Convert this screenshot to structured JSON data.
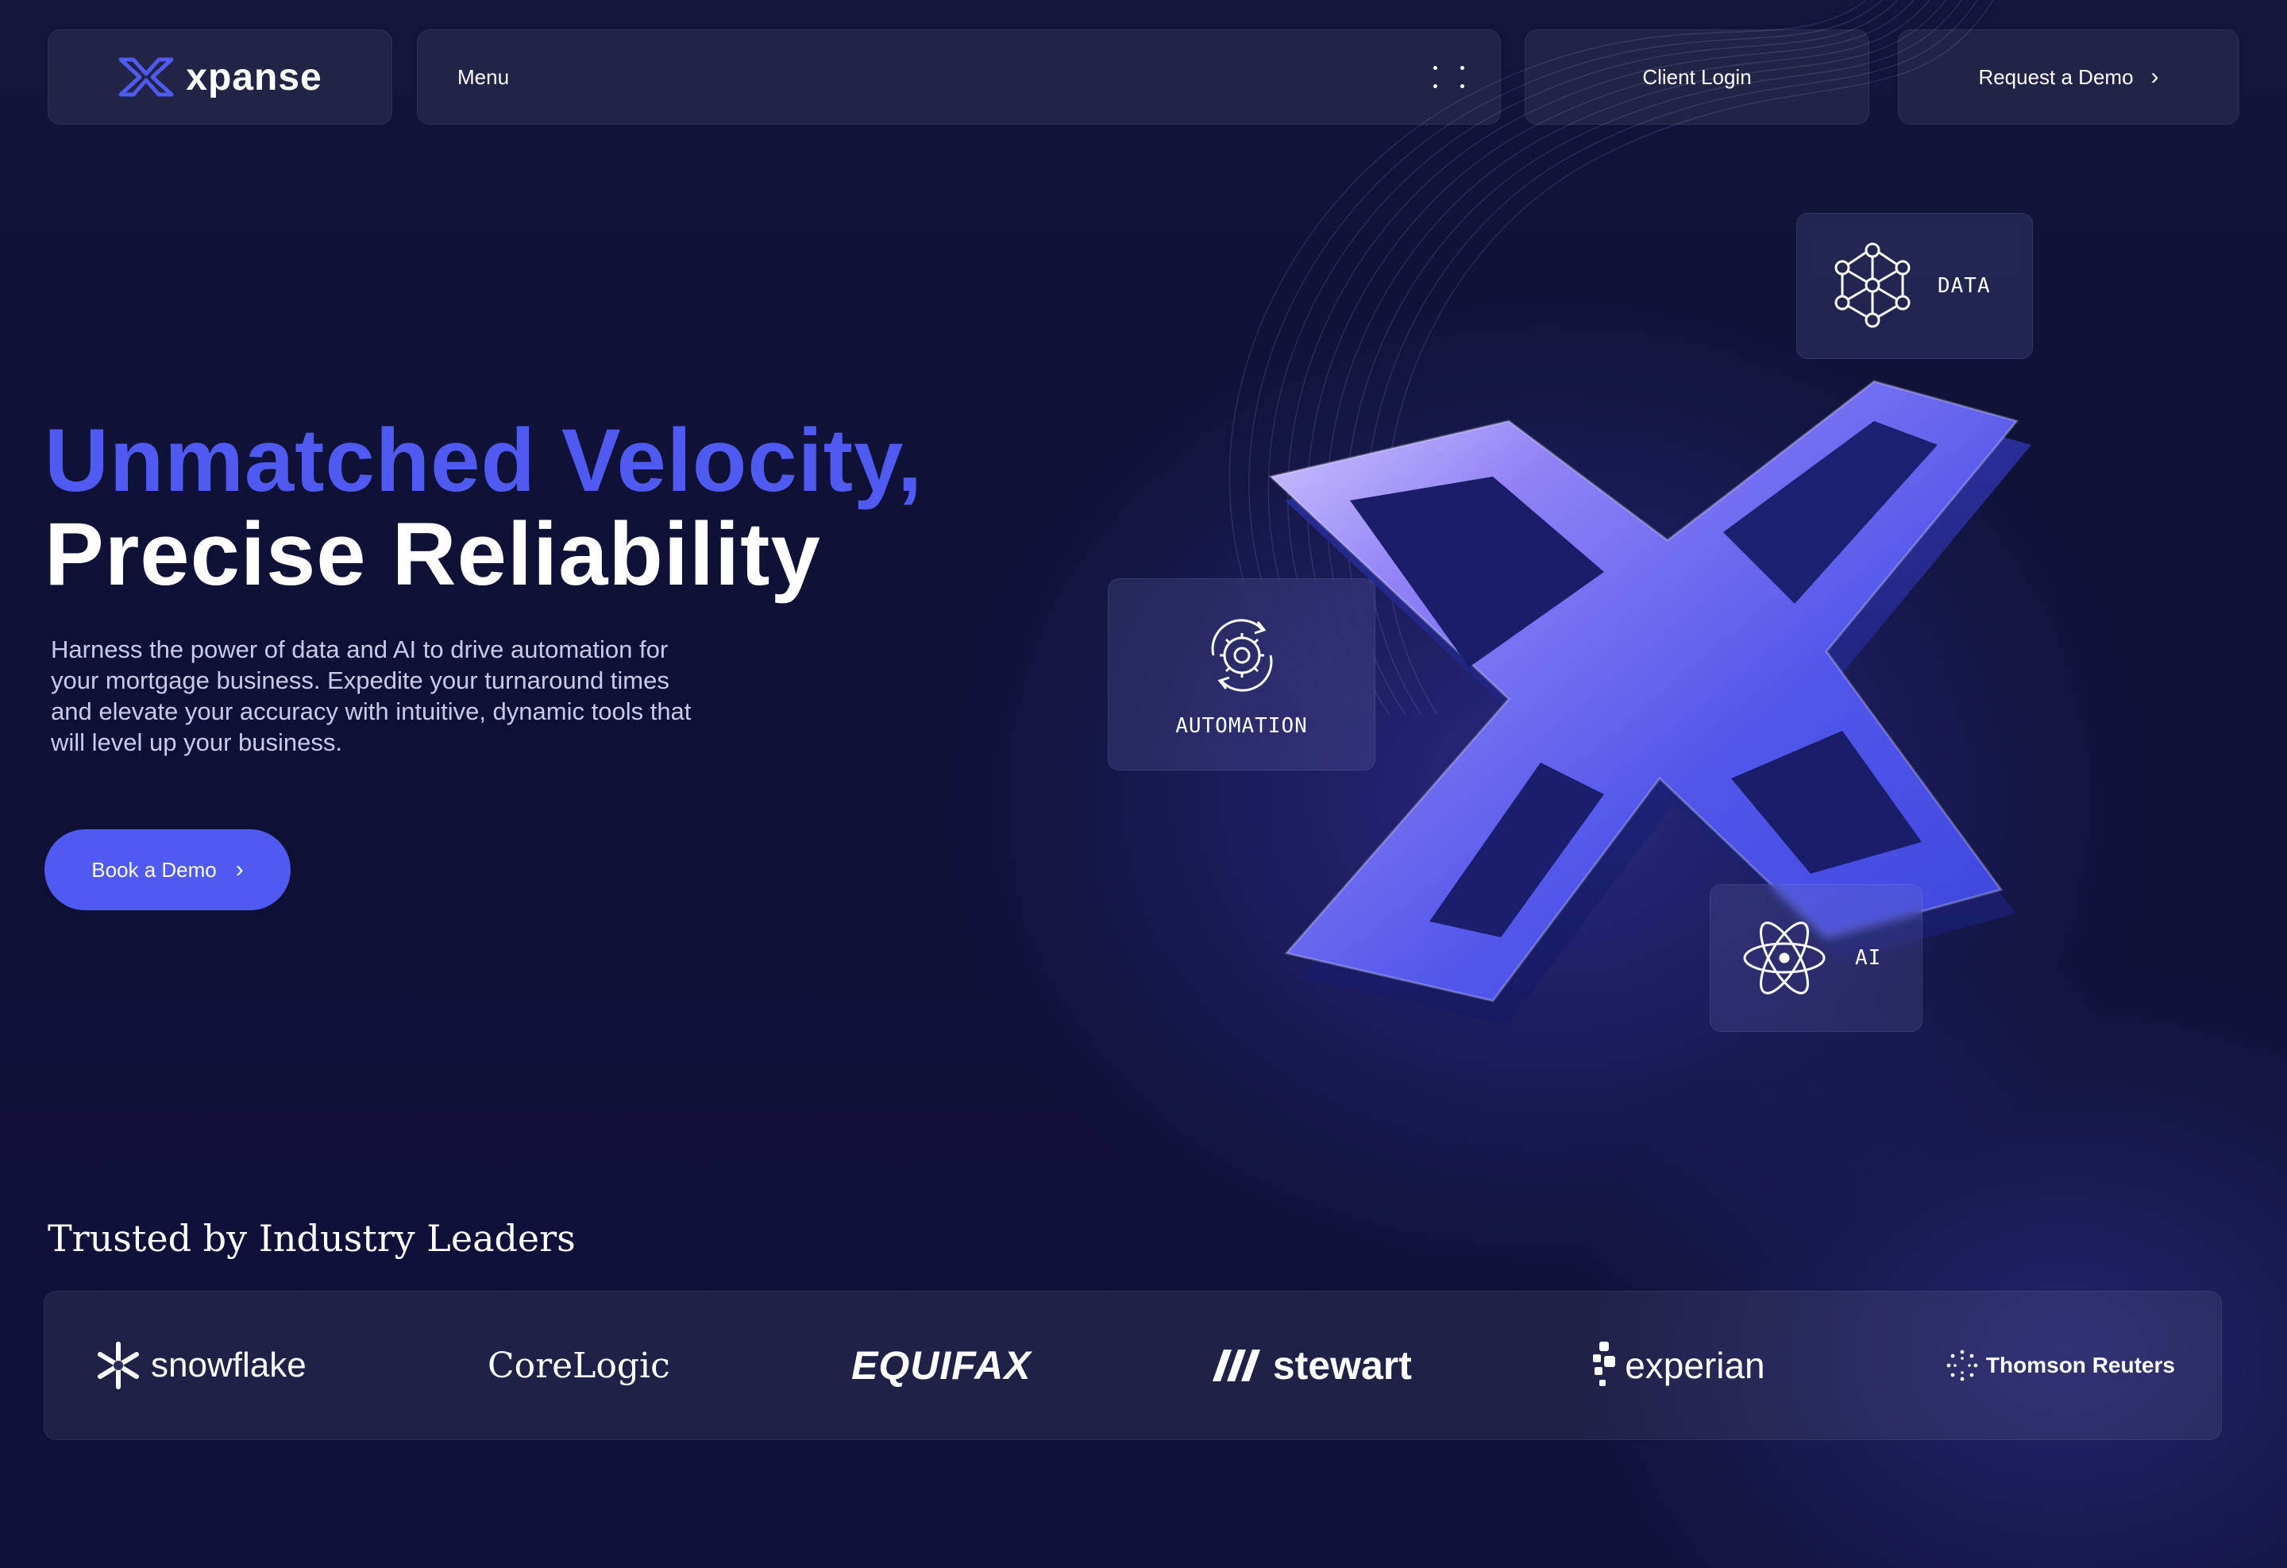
{
  "header": {
    "brand": "xpanse",
    "menu_label": "Menu",
    "client_login": "Client Login",
    "request_demo": "Request a Demo"
  },
  "hero": {
    "title_line1": "Unmatched Velocity,",
    "title_line2": "Precise Reliability",
    "description": "Harness the power of data and AI to drive automation for your mortgage business. Expedite your turnaround times and elevate your accuracy with intuitive, dynamic tools that will level up your business.",
    "cta": "Book a Demo"
  },
  "features": {
    "data": "DATA",
    "automation": "AUTOMATION",
    "ai": "AI"
  },
  "trusted": {
    "title": "Trusted by Industry Leaders",
    "logos": [
      "snowflake",
      "CoreLogic",
      "EQUIFAX",
      "stewart",
      "experian",
      "Thomson Reuters"
    ]
  },
  "colors": {
    "accent": "#4f5af0",
    "background": "#12143a"
  },
  "icons": [
    "x-logo-icon",
    "dots-grid-icon",
    "chevron-right-icon",
    "network-icon",
    "gear-sync-icon",
    "atom-icon"
  ]
}
